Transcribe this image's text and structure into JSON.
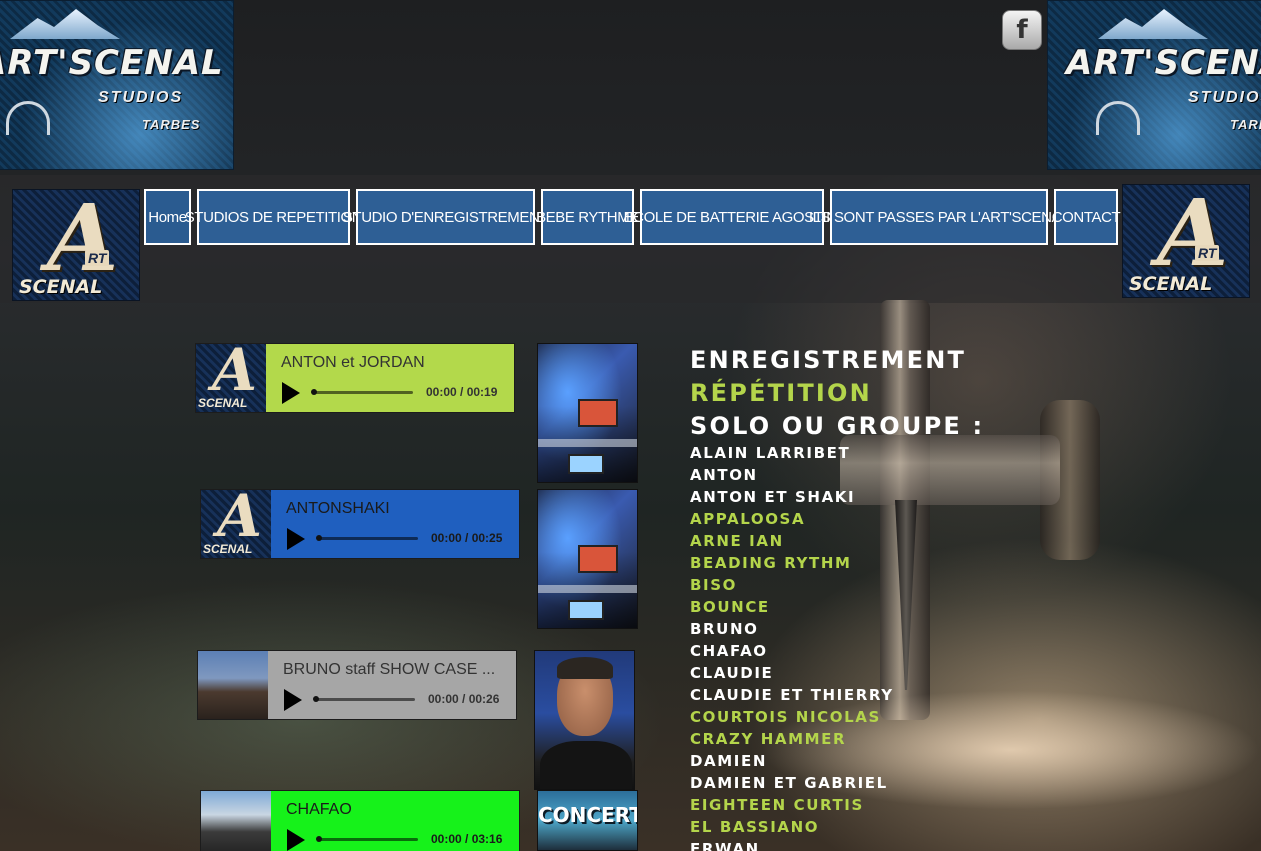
{
  "logos": {
    "brand": "ART'SCENAL",
    "subtitle": "STUDIOS",
    "city": "TARBES",
    "emblem_letter": "A",
    "emblem_rt": "RT",
    "emblem_word": "SCENAL"
  },
  "social": {
    "facebook_icon": "f"
  },
  "nav": {
    "items": [
      {
        "label": "Home"
      },
      {
        "label": "STUDIOS DE REPETITION"
      },
      {
        "label": "STUDIO D'ENREGISTREMENT"
      },
      {
        "label": "BEBE RYTHME"
      },
      {
        "label": "ECOLE DE BATTERIE AGOSTINI"
      },
      {
        "label": "ILS SONT PASSES PAR L'ART'SCENAL"
      },
      {
        "label": "CONTACT"
      }
    ]
  },
  "players": [
    {
      "title": "ANTON et JORDAN",
      "time": "00:00 / 00:19",
      "progress": 0.0,
      "color": "#b3d94b",
      "text_color": "#333333"
    },
    {
      "title": "ANTONSHAKI",
      "time": "00:00 / 00:25",
      "progress": 0.0,
      "color": "#1f5fbf",
      "text_color": "#1a1a1a"
    },
    {
      "title": "BRUNO staff SHOW CASE ...",
      "time": "00:00 / 00:26",
      "progress": 0.0,
      "color": "#a6a6a6",
      "text_color": "#333333"
    },
    {
      "title": "CHAFAO",
      "time": "00:00 / 03:16",
      "progress": 0.0,
      "color": "#16f21a",
      "text_color": "#1a1a1a"
    }
  ],
  "thumbnails": {
    "concert_text": "CONCERT"
  },
  "headings": [
    {
      "text": "ENREGISTREMENT",
      "color": "white"
    },
    {
      "text": "RÉPÉTITION",
      "color": "green"
    },
    {
      "text": "SOLO OU GROUPE :",
      "color": "white"
    }
  ],
  "artists": [
    {
      "name": "ALAIN LARRIBET",
      "color": "white"
    },
    {
      "name": "ANTON",
      "color": "white"
    },
    {
      "name": "ANTON ET SHAKI",
      "color": "white"
    },
    {
      "name": "APPALOOSA",
      "color": "green"
    },
    {
      "name": "ARNE IAN",
      "color": "green"
    },
    {
      "name": "BEADING RYTHM",
      "color": "green"
    },
    {
      "name": "BISO",
      "color": "green"
    },
    {
      "name": "BOUNCE",
      "color": "green"
    },
    {
      "name": "BRUNO",
      "color": "white"
    },
    {
      "name": "CHAFAO",
      "color": "white"
    },
    {
      "name": "CLAUDIE",
      "color": "white"
    },
    {
      "name": "CLAUDIE ET THIERRY",
      "color": "white"
    },
    {
      "name": "COURTOIS NICOLAS",
      "color": "green"
    },
    {
      "name": "CRAZY HAMMER",
      "color": "green"
    },
    {
      "name": "DAMIEN",
      "color": "white"
    },
    {
      "name": "DAMIEN ET GABRIEL",
      "color": "white"
    },
    {
      "name": "EIGHTEEN CURTIS",
      "color": "green"
    },
    {
      "name": "EL BASSIANO",
      "color": "green"
    },
    {
      "name": "ERWAN",
      "color": "white"
    }
  ]
}
